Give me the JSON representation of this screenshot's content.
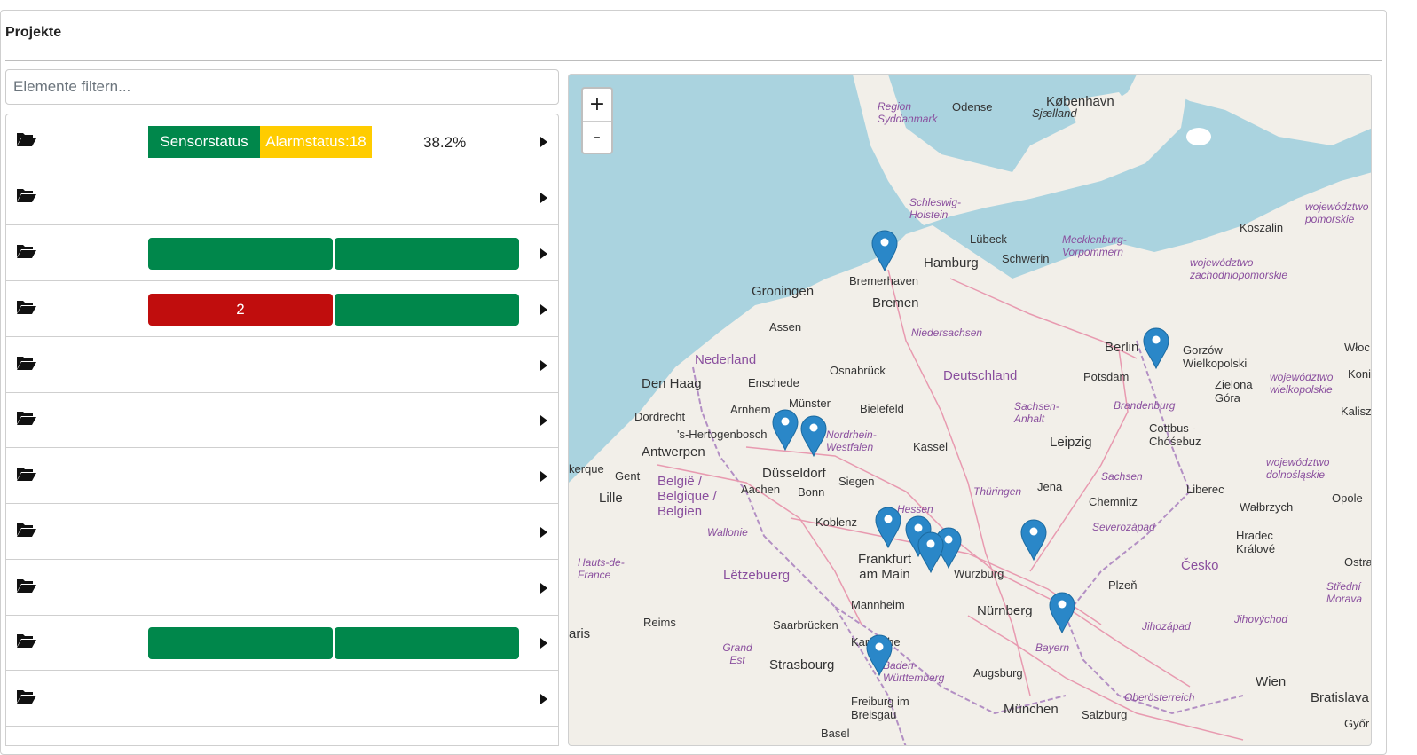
{
  "panel": {
    "title": "Projekte"
  },
  "filter": {
    "placeholder": "Elemente filtern..."
  },
  "rows": [
    {
      "sensor_label": "Sensorstatus",
      "alarm_label": "Alarmstatus:18",
      "percent": "38.2%"
    },
    {},
    {
      "left_bar": "",
      "right_bar": ""
    },
    {
      "left_bar": "2",
      "right_bar": ""
    },
    {},
    {},
    {},
    {},
    {},
    {
      "left_bar": "",
      "right_bar": ""
    },
    {}
  ],
  "colors": {
    "ok": "#00874b",
    "warn": "#ffcc00",
    "alarm": "#c00d0d",
    "pin": "#2a87c8"
  },
  "map": {
    "zoom_in": "+",
    "zoom_out": "-",
    "labels": {
      "kobenhavn": "København",
      "odense": "Odense",
      "sjaelland": "Sjælland",
      "region_syddanmark": "Region Syddanmark",
      "schleswig_holstein": "Schleswig-Holstein",
      "lubeck": "Lübeck",
      "hamburg": "Hamburg",
      "schwerin": "Schwerin",
      "mecklenburg": "Mecklenburg-Vorpommern",
      "koszalin": "Koszalin",
      "wojewodztwo_pomorskie": "województwo pomorskie",
      "wojewodztwo_zachodniopomorskie": "województwo zachodniopomorskie",
      "bremerhaven": "Bremerhaven",
      "bremen": "Bremen",
      "groningen": "Groningen",
      "assen": "Assen",
      "niedersachsen": "Niedersachsen",
      "nederland": "Nederland",
      "berlin": "Berlin",
      "potsdam": "Potsdam",
      "gorzow": "Gorzów Wielkopolski",
      "den_haag": "Den Haag",
      "enschede": "Enschede",
      "osnabruck": "Osnabrück",
      "deutschland": "Deutschland",
      "zielona_gora": "Zielona Góra",
      "wojewodztwo_wielkopolskie": "województwo wielkopolskie",
      "arnhem": "Arnhem",
      "munster": "Münster",
      "bielefeld": "Bielefeld",
      "sachsen_anhalt": "Sachsen-Anhalt",
      "brandenburg": "Brandenburg",
      "dordrecht": "Dordrecht",
      "s_hertogenbosch": "'s-Hertogenbosch",
      "nordrhein_westfalen": "Nordrhein-Westfalen",
      "kassel": "Kassel",
      "leipzig": "Leipzig",
      "cottbus": "Cottbus - Chóśebuz",
      "antwerpen": "Antwerpen",
      "dusseldorf": "Düsseldorf",
      "gent": "Gent",
      "belgie": "België / Belgique / Belgien",
      "aachen": "Aachen",
      "bonn": "Bonn",
      "siegen": "Siegen",
      "jena": "Jena",
      "thuringen": "Thüringen",
      "sachsen": "Sachsen",
      "liberec": "Liberec",
      "wojewodztwo_dolnoslaskie": "województwo dolnośląskie",
      "lille": "Lille",
      "wallonie": "Wallonie",
      "koblenz": "Koblenz",
      "hessen": "Hessen",
      "chemnitz": "Chemnitz",
      "severozapad": "Severozápad",
      "walbrzych": "Wałbrzych",
      "opole": "Opole",
      "hauts_de_france": "Hauts-de-France",
      "frankfurt": "Frankfurt am Main",
      "wurzburg": "Würzburg",
      "letzebuerg": "Lëtzebuerg",
      "plzen": "Plzeň",
      "cesko": "Česko",
      "hradec": "Hradec Králové",
      "ostrava": "Ostra",
      "mannheim": "Mannheim",
      "nurnberg": "Nürnberg",
      "reims": "Reims",
      "saarbrucken": "Saarbrücken",
      "paris": "aris",
      "karlsruhe": "Karlsruhe",
      "grand_est": "Grand Est",
      "strasbourg": "Strasbourg",
      "baden": "Baden-Württemberg",
      "augsburg": "Augsburg",
      "bayern": "Bayern",
      "jihozapad": "Jihozápad",
      "jihovychod": "Jihovýchod",
      "stredni_morava": "Střední Morava",
      "freiburg": "Freiburg im Breisgau",
      "munchen": "München",
      "salzburg": "Salzburg",
      "oberosterreich": "Oberösterreich",
      "wien": "Wien",
      "bratislava": "Bratislava",
      "gyor": "Győr",
      "kalisz": "Kalisz",
      "wloclawek": "Włoc",
      "konin": "Koni",
      "kerque": "kerque",
      "basel": "Basel"
    }
  }
}
